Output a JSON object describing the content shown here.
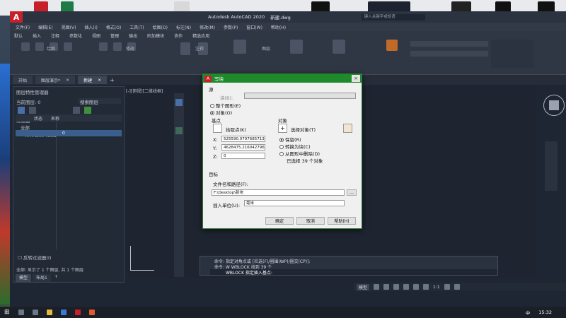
{
  "window": {
    "app_title": "Autodesk AutoCAD 2020",
    "file_title": "新建.dwg",
    "search_placeholder": "键入关键字或短语"
  },
  "menu": [
    "文件(F)",
    "编辑(E)",
    "视图(V)",
    "插入(I)",
    "格式(O)",
    "工具(T)",
    "绘图(D)",
    "标注(N)",
    "修改(M)",
    "参数(P)",
    "窗口(W)",
    "帮助(H)"
  ],
  "ribbon_tabs": [
    "默认",
    "插入",
    "注释",
    "参数化",
    "视图",
    "管理",
    "输出",
    "附加模块",
    "协作",
    "精选应用"
  ],
  "ribbon_groups": [
    "绘图",
    "修改",
    "注释",
    "图层"
  ],
  "file_tabs": [
    {
      "label": "开始"
    },
    {
      "label": "图层演示*"
    },
    {
      "label": "新建"
    }
  ],
  "layer_panel": {
    "title": "图层特性管理器",
    "current": "当前图层: 0",
    "search": "搜索图层",
    "filter": "过滤器",
    "tree_all": "全部",
    "tree_used": "所有使用的图层",
    "col_status": "状态",
    "col_name": "名称",
    "row_name": "0",
    "invert_label": "反转过滤器(I)",
    "summary": "全部: 显示了 1 个图层, 共 1 个图层"
  },
  "viewport": {
    "label": "[-][俯视][二维线框]"
  },
  "dialog": {
    "title": "写块",
    "source": "源",
    "block_label": "块(B):",
    "whole_label": "整个图形(E)",
    "objects_label": "对象(O)",
    "basepoint": "基点",
    "pick_label": "拾取点(K)",
    "x_label": "X:",
    "x_value": "525590.0797685713",
    "y_label": "Y:",
    "y_value": "4628475.216042796",
    "z_label": "Z:",
    "z_value": "0",
    "objects_group": "对象",
    "select_label": "选择对象(T)",
    "retain_label": "保留(R)",
    "convert_label": "转换为块(C)",
    "delete_label": "从图形中删除(D)",
    "selected_label": "已选择 39 个对象",
    "target": "目标",
    "filename_label": "文件名和路径(F):",
    "filename_value": "F:\\Desktop\\新块",
    "units_label": "插入单位(U):",
    "units_value": "毫米",
    "ok": "确定",
    "cancel": "取消",
    "help": "帮助(H)"
  },
  "command": {
    "line1": "命令: 指定对角点或 [栏选(F)/圈围(WP)/圈交(CP)]:",
    "line2": "命令: W WBLOCK 找到 39 个",
    "prompt": "WBLOCK 指定插入基点:"
  },
  "layout_tabs": [
    "模型",
    "布局1",
    "+"
  ],
  "statusbar": {
    "model": "模型",
    "scale": "1:1"
  },
  "taskbar": {
    "time": "15:32",
    "lang": "中"
  }
}
